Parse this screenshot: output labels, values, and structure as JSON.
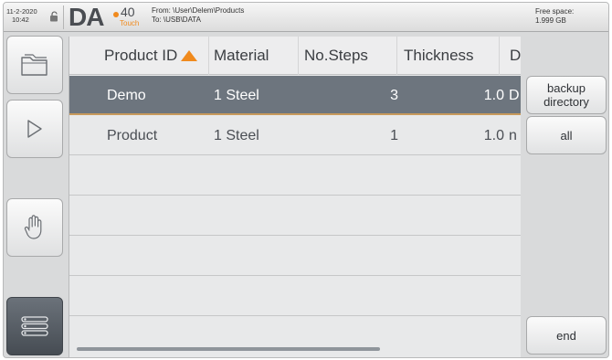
{
  "header": {
    "date": "11-2-2020",
    "time": "10:42",
    "logo_main": "DA",
    "logo_number": "40",
    "logo_sub": "Touch",
    "from_path": "From: \\User\\Delem\\Products",
    "to_path": "To: \\USB\\DATA",
    "free_space_label": "Free space:",
    "free_space_value": "1.999 GB",
    "accent_color": "#f08a1d"
  },
  "left_toolbar": {
    "items": [
      {
        "icon": "folder-icon"
      },
      {
        "icon": "play-icon"
      },
      {
        "icon": "hand-icon"
      },
      {
        "icon": "list-icon"
      }
    ]
  },
  "table": {
    "columns": [
      "Product ID",
      "Material",
      "No.Steps",
      "Thickness",
      "D"
    ],
    "sort_column": "Product ID",
    "sort_direction": "ascending",
    "rows": [
      {
        "product_id": "Demo",
        "material": "1 Steel",
        "steps": "3",
        "thickness": "1.0",
        "extra": "D",
        "selected": true
      },
      {
        "product_id": "Product",
        "material": "1 Steel",
        "steps": "1",
        "thickness": "1.0",
        "extra": "n",
        "selected": false
      }
    ]
  },
  "right_buttons": {
    "backup_line1": "backup",
    "backup_line2": "directory",
    "all": "all",
    "end": "end"
  }
}
